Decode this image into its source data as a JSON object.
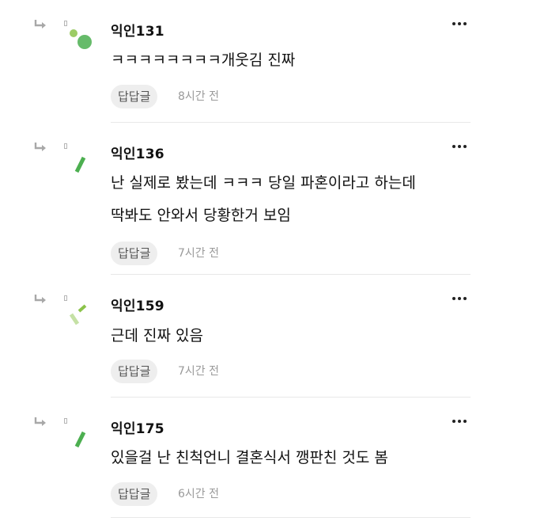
{
  "comments": [
    {
      "nickname": "익인131",
      "lines": [
        "ㅋㅋㅋㅋㅋㅋㅋㅋ개웃김 진짜"
      ],
      "reply_label": "답답글",
      "time": "8시간 전",
      "avatar_icon": "dot-avatar-icon",
      "avatar_colors": [
        "#9ccc65",
        "#66bb6a"
      ]
    },
    {
      "nickname": "익인136",
      "lines": [
        "난 실제로 봤는데 ㅋㅋㅋ 당일 파혼이라고 하는데",
        "딱봐도 안와서 당황한거 보임"
      ],
      "reply_label": "답답글",
      "time": "7시간 전",
      "avatar_icon": "slash-avatar-icon",
      "avatar_colors": [
        "#4caf50"
      ]
    },
    {
      "nickname": "익인159",
      "lines": [
        "근데 진짜 있음"
      ],
      "reply_label": "답답글",
      "time": "7시간 전",
      "avatar_icon": "double-slash-avatar-icon",
      "avatar_colors": [
        "#c5e1a5",
        "#8bc34a"
      ]
    },
    {
      "nickname": "익인175",
      "lines": [
        "있을걸 난 친척언니 결혼식서 깽판친 것도 봄"
      ],
      "reply_label": "답답글",
      "time": "6시간 전",
      "avatar_icon": "slash-avatar-icon",
      "avatar_colors": [
        "#4caf50"
      ]
    }
  ],
  "icons": {
    "reply_indicator": "reply-arrow-icon",
    "more": "more-dots-icon"
  }
}
